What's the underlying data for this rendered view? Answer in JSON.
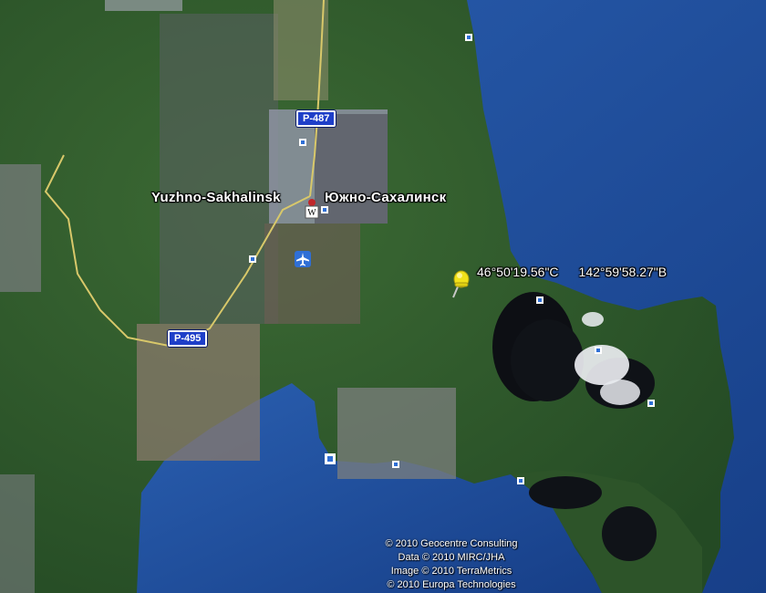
{
  "map": {
    "place_label_latin": "Yuzhno-Sakhalinsk",
    "place_label_cyrillic": "Южно-Сахалинск",
    "placemark": {
      "latitude": "46°50'19.56\"С",
      "longitude": "142°59'58.27\"В"
    },
    "roads": [
      {
        "label": "Р-487"
      },
      {
        "label": "Р-495"
      }
    ],
    "icons": [
      "wikipedia-icon",
      "airport-icon",
      "placemark-pin-icon",
      "poi-marker-icon"
    ],
    "colors": {
      "sea": "#1e4fa0",
      "land": "#2f5a2c",
      "road_shield": "#1f3fc9",
      "road_line": "#d8c86a",
      "pin": "#f2e21a"
    }
  },
  "copyright": {
    "lines": [
      "© 2010 Geocentre Consulting",
      "Data © 2010 MIRC/JHA",
      "Image © 2010 TerraMetrics",
      "© 2010 Europa Technologies"
    ]
  }
}
